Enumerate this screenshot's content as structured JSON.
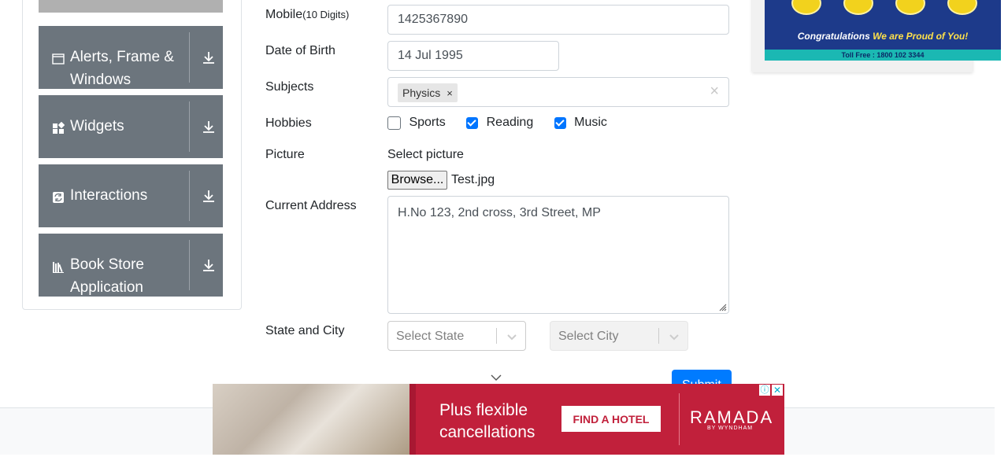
{
  "sidebar": {
    "groups": [
      {
        "label": "Alerts, Frame & Windows",
        "icon": "window-icon"
      },
      {
        "label": "Widgets",
        "icon": "widgets-icon"
      },
      {
        "label": "Interactions",
        "icon": "interactions-icon"
      },
      {
        "label": "Book Store Application",
        "icon": "books-icon"
      }
    ]
  },
  "form": {
    "mobile": {
      "label": "Mobile",
      "hint": "(10 Digits)",
      "value": "1425367890"
    },
    "dob": {
      "label": "Date of Birth",
      "value": "14 Jul 1995"
    },
    "subjects": {
      "label": "Subjects",
      "chip": "Physics",
      "chip_remove": "×",
      "clear": "×"
    },
    "hobbies": {
      "label": "Hobbies",
      "items": [
        {
          "label": "Sports",
          "checked": false
        },
        {
          "label": "Reading",
          "checked": true
        },
        {
          "label": "Music",
          "checked": true
        }
      ]
    },
    "picture": {
      "label": "Picture",
      "prompt": "Select picture",
      "browse": "Browse...",
      "file": "Test.jpg"
    },
    "address": {
      "label": "Current Address",
      "value": "H.No 123, 2nd cross, 3rd Street, MP"
    },
    "state_city": {
      "label": "State and City",
      "state_placeholder": "Select State",
      "city_placeholder": "Select City"
    },
    "submit": "Submit"
  },
  "ad_top": {
    "congrats_a": "Congratulations",
    "congrats_b": "We are Proud of You!",
    "tollfree": "Toll Free : 1800 102 3344"
  },
  "ad_bottom": {
    "line1": "Plus flexible",
    "line2": "cancellations",
    "button": "FIND A HOTEL",
    "brand": "RAMADA",
    "brand_sub": "BY WYNDHAM",
    "info": "ⓘ",
    "close": "✕"
  }
}
